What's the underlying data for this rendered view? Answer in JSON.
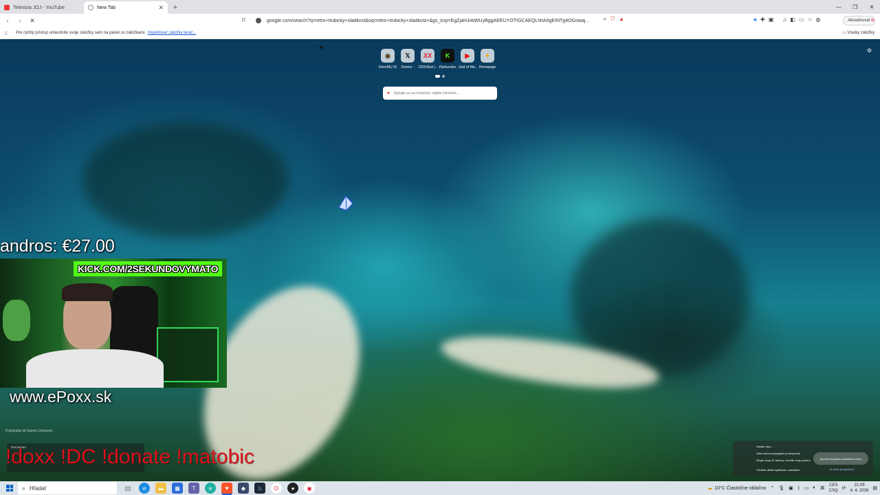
{
  "tabs": [
    {
      "title": "Televizia JOJ - YouTube",
      "color": "#e33"
    },
    {
      "title": "New Tab",
      "color": "#666"
    }
  ],
  "toolbar": {
    "url": "google.com/search?q=retro+trubicky+sladkost&oq=retro+trubicky+sladkost+&gs_lcrp=EgZjaHJvbWUyBggAEEUYOTIGCAEQLhhA0gEINTg4OGowaj...",
    "update_label": "Aktualizovať"
  },
  "bookmarks_bar": {
    "hint": "Pre rýchly prístup umiestnite svoje záložky sem na panel so záložkami.",
    "import_link": "Importovať záložky teraz...",
    "all_bookmarks": "Všetky záložky"
  },
  "shortcuts": [
    {
      "label": "EternMU S6 (f) Domov -",
      "glyph": "◉",
      "color": "#5a4a2a"
    },
    {
      "label": "Domov -",
      "glyph": "𝕏",
      "color": "#111"
    },
    {
      "label": "DOXXbet |...",
      "glyph": "XX",
      "color": "#e0102a"
    },
    {
      "label": "2Sekundov...",
      "glyph": "K",
      "color": "#53fc18"
    },
    {
      "label": "God of Wa...",
      "glyph": "▶",
      "color": "#e00"
    },
    {
      "label": "Homepage",
      "glyph": "✦",
      "color": "#f3a81c"
    }
  ],
  "search": {
    "placeholder": "Spýtajte sa na čokoľvek, nájdite čokoľvek..."
  },
  "photo_credit": "Fotografia od Sames Unknown",
  "overlay": {
    "donation": "andros: €27.00",
    "kick": "KICK.COM/2SEKUNDOVYMATO",
    "website": "www.ePoxx.sk",
    "stats_title": "ŠTATISTIKY",
    "commands": "!doxx !DC !donate !matobic"
  },
  "notification": {
    "title": "Všetko vám...",
    "line1": "Vaše sieťové pripojenie je bezpečné",
    "line2": "Skryte svoju IP adresu, zmeňte svoju polohu",
    "line3": "Chráňte ďalšie aplikácie v zariadení",
    "button": "Spustiť bezplatnú skúšobnú verziu",
    "link": "Už máte predplatné?"
  },
  "taskbar": {
    "search_label": "Hľadať",
    "weather": "10°C  Čiastočne oblačno",
    "lang": "CES",
    "lang2": "CSQ",
    "time": "21:09",
    "date": "4. 4. 2026"
  }
}
